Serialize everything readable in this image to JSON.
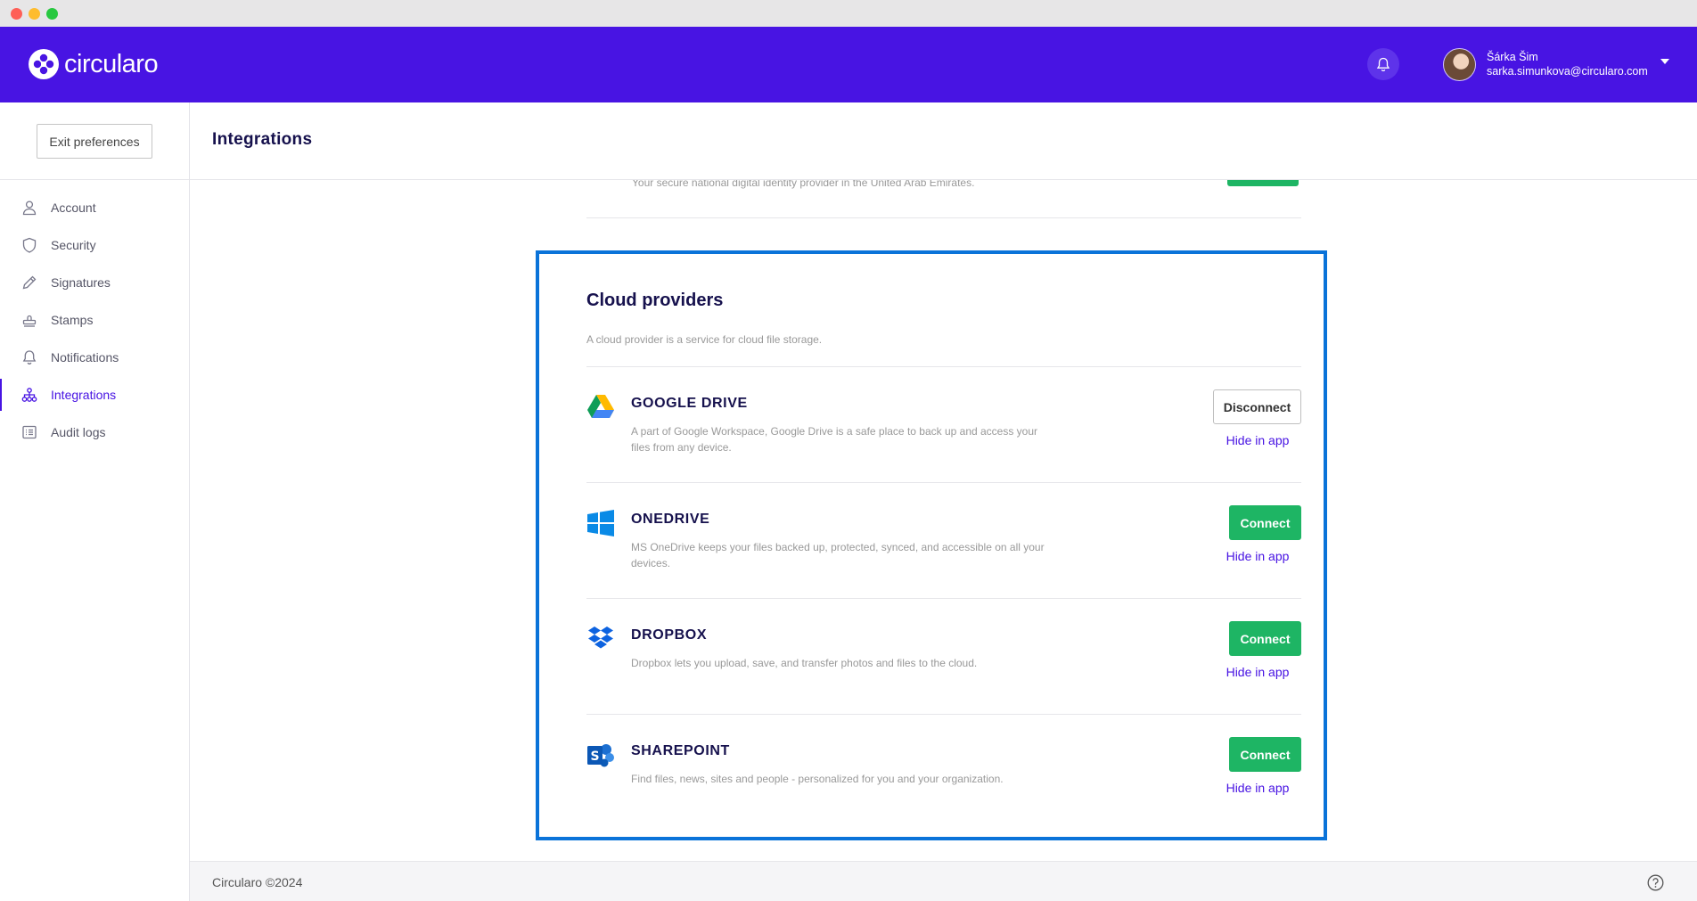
{
  "brand": {
    "name": "circularo",
    "accent": "#4814e3",
    "connect_color": "#1eb564",
    "highlight_color": "#0a73d9"
  },
  "header": {
    "notification_icon": "bell-icon",
    "user": {
      "name": "Šárka Šim",
      "email": "sarka.simunkova@circularo.com"
    }
  },
  "sidebar": {
    "exit_label": "Exit preferences",
    "items": [
      {
        "label": "Account",
        "icon": "user-icon"
      },
      {
        "label": "Security",
        "icon": "shield-icon"
      },
      {
        "label": "Signatures",
        "icon": "pen-icon"
      },
      {
        "label": "Stamps",
        "icon": "stamp-icon"
      },
      {
        "label": "Notifications",
        "icon": "bell-icon"
      },
      {
        "label": "Integrations",
        "icon": "network-icon",
        "active": true
      },
      {
        "label": "Audit logs",
        "icon": "list-icon"
      }
    ]
  },
  "page": {
    "title": "Integrations"
  },
  "previous_section": {
    "description": "Your secure national digital identity provider in the United Arab Emirates."
  },
  "cloud": {
    "title": "Cloud providers",
    "description": "A cloud provider is a service for cloud file storage.",
    "providers": [
      {
        "name": "GOOGLE DRIVE",
        "icon": "google-drive-icon",
        "description": "A part of Google Workspace, Google Drive is a safe place to back up and access your files from any device.",
        "action": "Disconnect",
        "hide": "Hide in app"
      },
      {
        "name": "ONEDRIVE",
        "icon": "windows-icon",
        "description": "MS OneDrive keeps your files backed up, protected, synced, and accessible on all your devices.",
        "action": "Connect",
        "hide": "Hide in app"
      },
      {
        "name": "DROPBOX",
        "icon": "dropbox-icon",
        "description": "Dropbox lets you upload, save, and transfer photos and files to the cloud.",
        "action": "Connect",
        "hide": "Hide in app"
      },
      {
        "name": "SHAREPOINT",
        "icon": "sharepoint-icon",
        "description": "Find files, news, sites and people - personalized for you and your organization.",
        "action": "Connect",
        "hide": "Hide in app"
      }
    ]
  },
  "footer": {
    "copyright": "Circularo ©2024",
    "help_icon": "help-icon"
  }
}
